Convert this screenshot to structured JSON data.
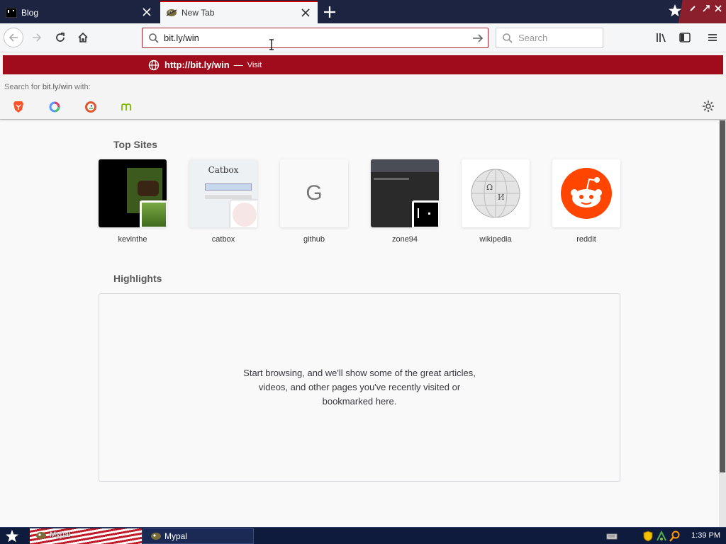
{
  "tabs": [
    {
      "title": "Blog",
      "active": false
    },
    {
      "title": "New Tab",
      "active": true
    }
  ],
  "toolbar": {
    "url_value": "bit.ly/win",
    "search_placeholder": "Search"
  },
  "autocomplete": {
    "url_prefix": "http://",
    "url_bold": "bit.ly/win",
    "separator": "—",
    "action": "Visit",
    "search_with_prefix": "Search for ",
    "search_with_query": "bit.ly/win",
    "search_with_suffix": " with:",
    "engines": [
      "brave-icon",
      "qwant-icon",
      "duckduckgo-icon",
      "mojeek-icon"
    ]
  },
  "top_sites": {
    "heading": "Top Sites",
    "items": [
      {
        "label": "kevinthe"
      },
      {
        "label": "catbox",
        "tile_text": "Catbox"
      },
      {
        "label": "github",
        "letter": "G"
      },
      {
        "label": "zone94"
      },
      {
        "label": "wikipedia"
      },
      {
        "label": "reddit"
      }
    ]
  },
  "highlights": {
    "heading": "Highlights",
    "empty_message": "Start browsing, and we'll show some of the great articles, videos, and other pages you've recently visited or bookmarked here."
  },
  "taskbar": {
    "pinned_label": "Mypal",
    "task_label": "Mypal",
    "clock": "1:39 PM"
  },
  "colors": {
    "accent_red": "#a00c1c",
    "tabbar": "#1c2442",
    "reddit": "#ff4500"
  }
}
